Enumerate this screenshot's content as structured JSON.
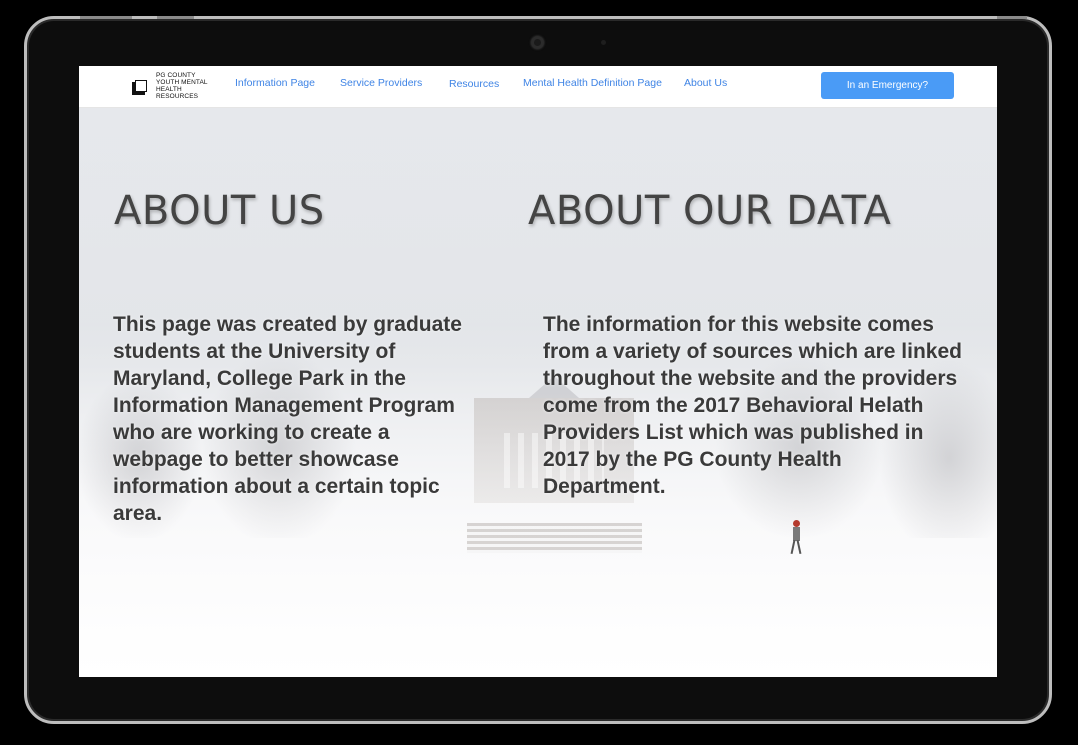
{
  "logo": {
    "lines": [
      "PG COUNTY",
      "YOUTH MENTAL",
      "HEALTH",
      "RESOURCES"
    ]
  },
  "nav": {
    "items": [
      {
        "label": "Information Page"
      },
      {
        "label": "Service Providers"
      },
      {
        "label": "Resources"
      },
      {
        "label": "Mental Health Definition Page"
      },
      {
        "label": "About Us"
      }
    ],
    "emergency_label": "In an Emergency?"
  },
  "about_us": {
    "title": "ABOUT US",
    "text": "This page was created by graduate students at the University of Maryland, College Park in the Information Management Program who are working to create a webpage to better showcase information about a certain topic area."
  },
  "about_data": {
    "title": "ABOUT OUR DATA",
    "text": "The information for this website comes from a variety of sources which are linked throughout the website and the providers come from the 2017 Behavioral Helath Providers List which was published in 2017 by the PG County Health Department."
  },
  "colors": {
    "link": "#3f84e5",
    "button": "#4a9bf6",
    "heading": "#444444"
  }
}
